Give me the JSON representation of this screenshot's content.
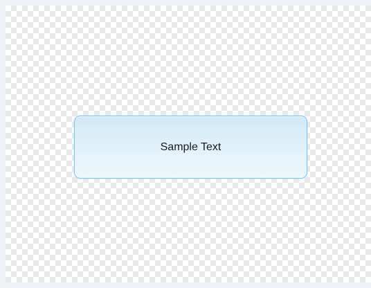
{
  "button": {
    "label": "Sample Text"
  },
  "colors": {
    "border": "#7cc4ec",
    "fill_top": "#cfe9f8",
    "fill_bottom": "#eef8fd",
    "checker": "#e9e9e9"
  }
}
